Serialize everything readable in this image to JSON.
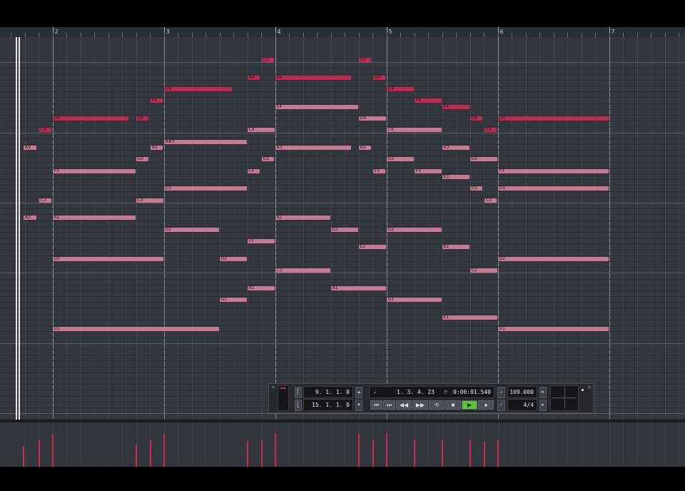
{
  "ruler": {
    "bars": [
      {
        "label": "2"
      },
      {
        "label": "3"
      },
      {
        "label": "4"
      },
      {
        "label": "5"
      },
      {
        "label": "6"
      },
      {
        "label": "7"
      }
    ]
  },
  "colors": {
    "note_light": "#c47a94",
    "note_dark": "#c02a52",
    "play_active": "#59c43a",
    "grid_bg": "#32363d"
  },
  "notes": [
    {
      "label": "A3",
      "start": 0.05,
      "len": 0.12,
      "pitch": "A3",
      "tone": "light"
    },
    {
      "label": "A2",
      "start": 0.05,
      "len": 0.12,
      "pitch": "A2",
      "tone": "light"
    },
    {
      "label": "C4",
      "start": 0.19,
      "len": 0.12,
      "pitch": "C4",
      "tone": "dark"
    },
    {
      "label": "C3",
      "start": 0.19,
      "len": 0.12,
      "pitch": "C3",
      "tone": "light"
    },
    {
      "label": "D4",
      "start": 0.31,
      "len": 0.69,
      "pitch": "D4",
      "tone": "dark"
    },
    {
      "label": "F3",
      "start": 0.31,
      "len": 0.75,
      "pitch": "F3",
      "tone": "light"
    },
    {
      "label": "A2",
      "start": 0.31,
      "len": 0.75,
      "pitch": "A2",
      "tone": "light"
    },
    {
      "label": "D2",
      "start": 0.31,
      "len": 1.0,
      "pitch": "D2",
      "tone": "light"
    },
    {
      "label": "D1",
      "start": 0.31,
      "len": 1.5,
      "pitch": "D1",
      "tone": "light"
    },
    {
      "label": "D4",
      "start": 1.06,
      "len": 0.12,
      "pitch": "D4",
      "tone": "dark"
    },
    {
      "label": "G3",
      "start": 1.06,
      "len": 0.12,
      "pitch": "G3",
      "tone": "light"
    },
    {
      "label": "C3",
      "start": 1.06,
      "len": 0.25,
      "pitch": "C3",
      "tone": "light"
    },
    {
      "label": "F4",
      "start": 1.19,
      "len": 0.12,
      "pitch": "F4",
      "tone": "dark"
    },
    {
      "label": "A3",
      "start": 1.19,
      "len": 0.12,
      "pitch": "A3",
      "tone": "light"
    },
    {
      "label": "G4",
      "start": 1.31,
      "len": 0.62,
      "pitch": "G4",
      "tone": "dark"
    },
    {
      "label": "A#3",
      "start": 1.31,
      "len": 0.75,
      "pitch": "A#3",
      "tone": "light"
    },
    {
      "label": "D3",
      "start": 1.31,
      "len": 0.75,
      "pitch": "D3",
      "tone": "light"
    },
    {
      "label": "G2",
      "start": 1.31,
      "len": 0.5,
      "pitch": "G2",
      "tone": "light"
    },
    {
      "label": "D2",
      "start": 1.81,
      "len": 0.25,
      "pitch": "D2",
      "tone": "light"
    },
    {
      "label": "G1",
      "start": 1.81,
      "len": 0.25,
      "pitch": "G1",
      "tone": "light"
    },
    {
      "label": "A4",
      "start": 2.06,
      "len": 0.12,
      "pitch": "A4",
      "tone": "dark"
    },
    {
      "label": "C4",
      "start": 2.06,
      "len": 0.25,
      "pitch": "C4",
      "tone": "light"
    },
    {
      "label": "F3",
      "start": 2.06,
      "len": 0.12,
      "pitch": "F3",
      "tone": "light"
    },
    {
      "label": "F2",
      "start": 2.06,
      "len": 0.25,
      "pitch": "F2",
      "tone": "light"
    },
    {
      "label": "A1",
      "start": 2.06,
      "len": 0.25,
      "pitch": "A1",
      "tone": "light"
    },
    {
      "label": "C5",
      "start": 2.19,
      "len": 0.12,
      "pitch": "C5",
      "tone": "dark"
    },
    {
      "label": "G3",
      "start": 2.19,
      "len": 0.12,
      "pitch": "G3",
      "tone": "light"
    },
    {
      "label": "A4",
      "start": 2.31,
      "len": 0.69,
      "pitch": "A4",
      "tone": "dark"
    },
    {
      "label": "E4",
      "start": 2.31,
      "len": 0.75,
      "pitch": "E4",
      "tone": "light"
    },
    {
      "label": "A3",
      "start": 2.31,
      "len": 0.69,
      "pitch": "A3",
      "tone": "light"
    },
    {
      "label": "A2",
      "start": 2.31,
      "len": 0.5,
      "pitch": "A2",
      "tone": "light"
    },
    {
      "label": "C2",
      "start": 2.31,
      "len": 0.5,
      "pitch": "C2",
      "tone": "light"
    },
    {
      "label": "G2",
      "start": 2.81,
      "len": 0.25,
      "pitch": "G2",
      "tone": "light"
    },
    {
      "label": "A1",
      "start": 2.81,
      "len": 0.5,
      "pitch": "A1",
      "tone": "light"
    },
    {
      "label": "C5",
      "start": 3.06,
      "len": 0.12,
      "pitch": "C5",
      "tone": "dark"
    },
    {
      "label": "D4",
      "start": 3.06,
      "len": 0.25,
      "pitch": "D4",
      "tone": "light"
    },
    {
      "label": "A3",
      "start": 3.06,
      "len": 0.12,
      "pitch": "A3",
      "tone": "light"
    },
    {
      "label": "E2",
      "start": 3.06,
      "len": 0.25,
      "pitch": "E2",
      "tone": "light"
    },
    {
      "label": "A4",
      "start": 3.19,
      "len": 0.12,
      "pitch": "A4",
      "tone": "dark"
    },
    {
      "label": "F3",
      "start": 3.19,
      "len": 0.12,
      "pitch": "F3",
      "tone": "light"
    },
    {
      "label": "G4",
      "start": 3.31,
      "len": 0.25,
      "pitch": "G4",
      "tone": "dark"
    },
    {
      "label": "C4",
      "start": 3.31,
      "len": 0.5,
      "pitch": "C4",
      "tone": "light"
    },
    {
      "label": "G3",
      "start": 3.31,
      "len": 0.25,
      "pitch": "G3",
      "tone": "light"
    },
    {
      "label": "G2",
      "start": 3.31,
      "len": 0.5,
      "pitch": "G2",
      "tone": "light"
    },
    {
      "label": "G1",
      "start": 3.31,
      "len": 0.5,
      "pitch": "G1",
      "tone": "light"
    },
    {
      "label": "F4",
      "start": 3.56,
      "len": 0.25,
      "pitch": "F4",
      "tone": "dark"
    },
    {
      "label": "F3",
      "start": 3.56,
      "len": 0.25,
      "pitch": "F3",
      "tone": "light"
    },
    {
      "label": "E4",
      "start": 3.81,
      "len": 0.25,
      "pitch": "E4",
      "tone": "dark"
    },
    {
      "label": "A3",
      "start": 3.81,
      "len": 0.25,
      "pitch": "A3",
      "tone": "light"
    },
    {
      "label": "E3",
      "start": 3.81,
      "len": 0.25,
      "pitch": "E3",
      "tone": "light"
    },
    {
      "label": "E2",
      "start": 3.81,
      "len": 0.25,
      "pitch": "E2",
      "tone": "light"
    },
    {
      "label": "E1",
      "start": 3.81,
      "len": 0.5,
      "pitch": "E1",
      "tone": "light"
    },
    {
      "label": "D4",
      "start": 4.06,
      "len": 0.12,
      "pitch": "D4",
      "tone": "dark"
    },
    {
      "label": "G3",
      "start": 4.06,
      "len": 0.25,
      "pitch": "G3",
      "tone": "light"
    },
    {
      "label": "D3",
      "start": 4.06,
      "len": 0.12,
      "pitch": "D3",
      "tone": "light"
    },
    {
      "label": "C2",
      "start": 4.06,
      "len": 0.25,
      "pitch": "C2",
      "tone": "light"
    },
    {
      "label": "C4",
      "start": 4.19,
      "len": 0.12,
      "pitch": "C4",
      "tone": "dark"
    },
    {
      "label": "C3",
      "start": 4.19,
      "len": 0.12,
      "pitch": "C3",
      "tone": "light"
    },
    {
      "label": "D4",
      "start": 4.31,
      "len": 1.0,
      "pitch": "D4",
      "tone": "dark"
    },
    {
      "label": "F3",
      "start": 4.31,
      "len": 1.0,
      "pitch": "F3",
      "tone": "light"
    },
    {
      "label": "D3",
      "start": 4.31,
      "len": 1.0,
      "pitch": "D3",
      "tone": "light"
    },
    {
      "label": "D2",
      "start": 4.31,
      "len": 1.0,
      "pitch": "D2",
      "tone": "light"
    },
    {
      "label": "D1",
      "start": 4.31,
      "len": 1.0,
      "pitch": "D1",
      "tone": "light"
    }
  ],
  "velocities": [
    0.55,
    0.72,
    0.88,
    0.6,
    0.72,
    0.88,
    0.7,
    0.72,
    0.9,
    0.88,
    0.72,
    0.9,
    0.72,
    0.72,
    0.72,
    0.68,
    0.72,
    0.72
  ],
  "velocity_times": [
    0.05,
    0.19,
    0.31,
    1.06,
    1.19,
    1.31,
    2.06,
    2.19,
    2.31,
    3.06,
    3.19,
    3.31,
    3.56,
    3.81,
    4.06,
    4.19,
    4.31,
    4.31
  ],
  "transport": {
    "left_locator": "9. 1. 1.   0",
    "right_locator": "15. 1. 1.   0",
    "position_bars": "1. 3. 4. 23",
    "position_time": "0:00:01.540",
    "tempo": "109.000",
    "signature": "4/4",
    "buttons": {
      "rewind_start": "⏮",
      "go_end": "⏭",
      "rewind": "◀◀",
      "forward": "▶▶",
      "cycle": "⟲",
      "stop": "■",
      "play": "▶",
      "record": "●"
    },
    "close": "✕",
    "metronome": "𝅘𝅥",
    "clock": "◷"
  }
}
